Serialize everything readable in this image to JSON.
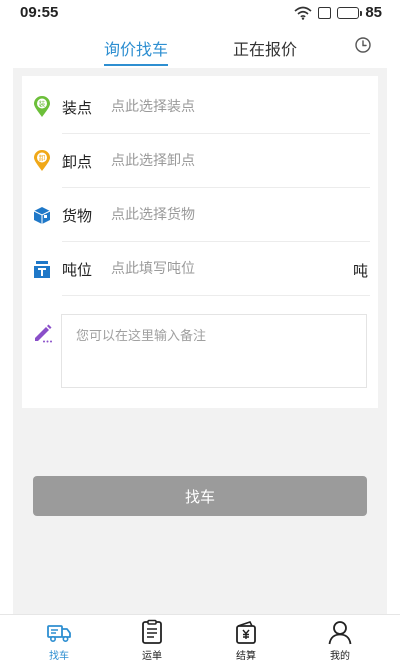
{
  "status_bar": {
    "time": "09:55",
    "battery": "85"
  },
  "tabs": [
    {
      "label": "询价找车",
      "active": true
    },
    {
      "label": "正在报价",
      "active": false
    }
  ],
  "form": {
    "loading": {
      "label": "装点",
      "placeholder": "点此选择装点",
      "icon_glyph": "装"
    },
    "unloading": {
      "label": "卸点",
      "placeholder": "点此选择卸点",
      "icon_glyph": "卸"
    },
    "goods": {
      "label": "货物",
      "placeholder": "点此选择货物"
    },
    "tonnage": {
      "label": "吨位",
      "placeholder": "点此填写吨位",
      "unit": "吨"
    },
    "remark": {
      "placeholder": "您可以在这里输入备注"
    }
  },
  "find_button": {
    "label": "找车"
  },
  "bottom_nav": [
    {
      "label": "找车",
      "icon": "truck-icon",
      "active": true
    },
    {
      "label": "运单",
      "icon": "clipboard-icon",
      "active": false
    },
    {
      "label": "结算",
      "icon": "wallet-icon",
      "active": false
    },
    {
      "label": "我的",
      "icon": "user-icon",
      "active": false
    }
  ],
  "colors": {
    "accent": "#2e8fd1",
    "loading_pin": "#6cbf3a",
    "unloading_pin": "#f0a818",
    "goods_icon": "#1f78c8",
    "tonnage_icon": "#1f78c8",
    "remark_icon": "#8a4fc9",
    "button_disabled": "#9b9b9b"
  }
}
